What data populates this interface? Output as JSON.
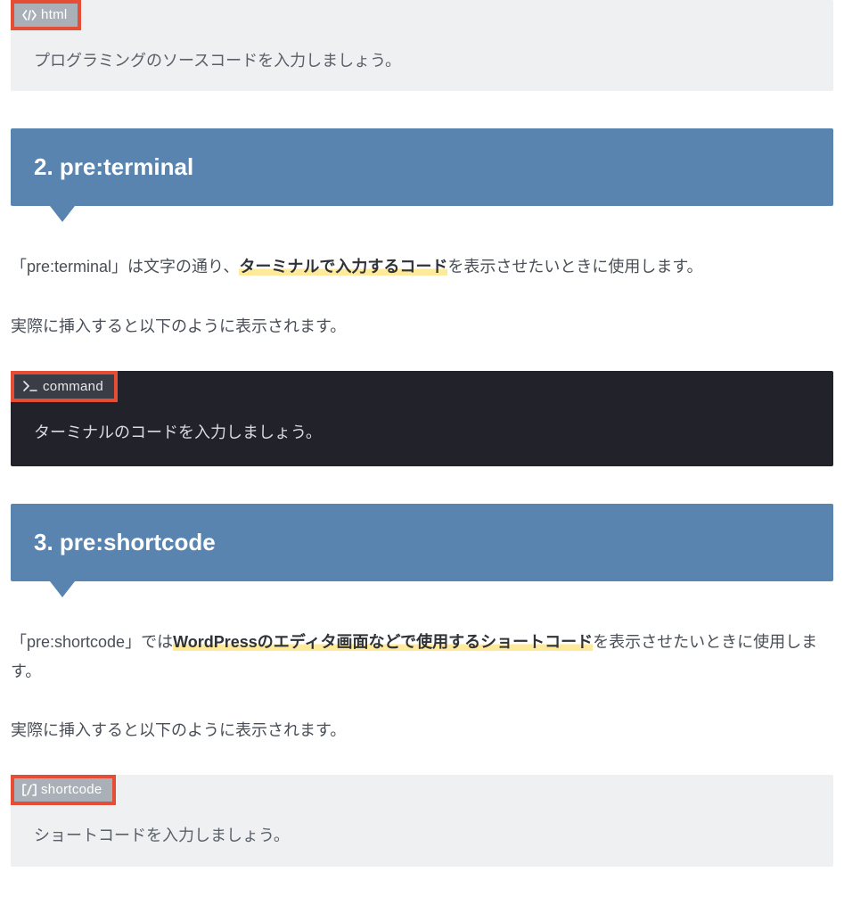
{
  "block1": {
    "label_icon": "code-icon",
    "label_text": "html",
    "body": "プログラミングのソースコードを入力しましょう。"
  },
  "heading2": "2. pre:terminal",
  "para2a_pre": "「pre:terminal」は文字の通り、",
  "para2a_hl": "ターミナルで入力するコード",
  "para2a_post": "を表示させたいときに使用します。",
  "para2b": "実際に挿入すると以下のように表示されます。",
  "block2": {
    "label_icon": "terminal-icon",
    "label_text": "command",
    "body": "ターミナルのコードを入力しましょう。"
  },
  "heading3": "3. pre:shortcode",
  "para3a_pre": "「pre:shortcode」では",
  "para3a_hl": "WordPressのエディタ画面などで使用するショートコード",
  "para3a_post": "を表示させたいときに使用します。",
  "para3b": "実際に挿入すると以下のように表示されます。",
  "block3": {
    "label_icon": "shortcode-icon",
    "label_text": "shortcode",
    "body": "ショートコードを入力しましょう。"
  }
}
